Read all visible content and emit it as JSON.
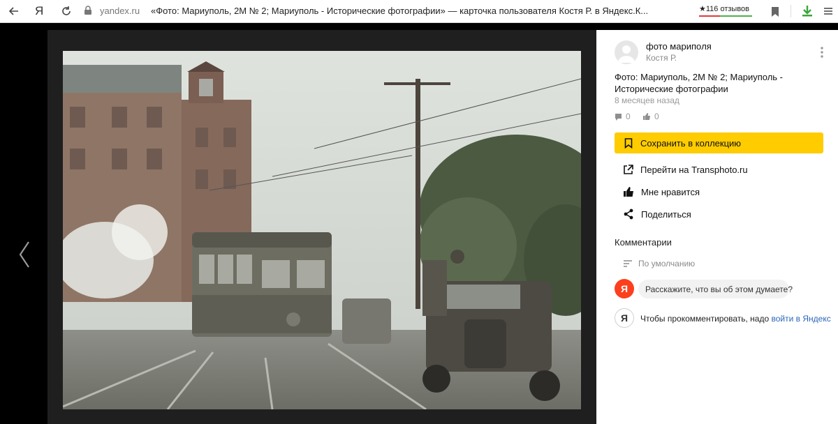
{
  "browser": {
    "yandex_letter": "Я",
    "domain": "yandex.ru",
    "tab_title": "«Фото: Мариуполь, 2М № 2; Мариуполь - Исторические фотографии» — карточка пользователя Костя Р. в Яндекс.К...",
    "reviews": "★116 отзывов",
    "icons": [
      "back-arrow-icon",
      "reload-icon",
      "lock-icon",
      "bookmark-icon",
      "download-icon",
      "menu-icon"
    ]
  },
  "viewer": {
    "prev_icon": "chevron-left-icon"
  },
  "card": {
    "collection": "фото марипoля",
    "author": "Костя Р.",
    "description": "Фото: Мариуполь, 2М № 2; Мариуполь - Исторические фотографии",
    "time": "8 месяцев назад",
    "comments_count": "0",
    "likes_count": "0",
    "save_label": "Сохранить в коллекцию",
    "goto_label": "Перейти на Transphoto.ru",
    "like_label": "Мне нравится",
    "share_label": "Поделиться",
    "comments_title": "Комментарии",
    "sort_label": "По умолчанию",
    "ya_letter": "Я",
    "comment_placeholder": "Расскажите, что вы об этом думаете?",
    "login_prefix": "Чтобы прокомментировать, надо ",
    "login_link": "войти в Яндекс"
  },
  "colors": {
    "accent": "#ffcc00",
    "yandex_red": "#fc3f1d",
    "link": "#2a66b8"
  }
}
